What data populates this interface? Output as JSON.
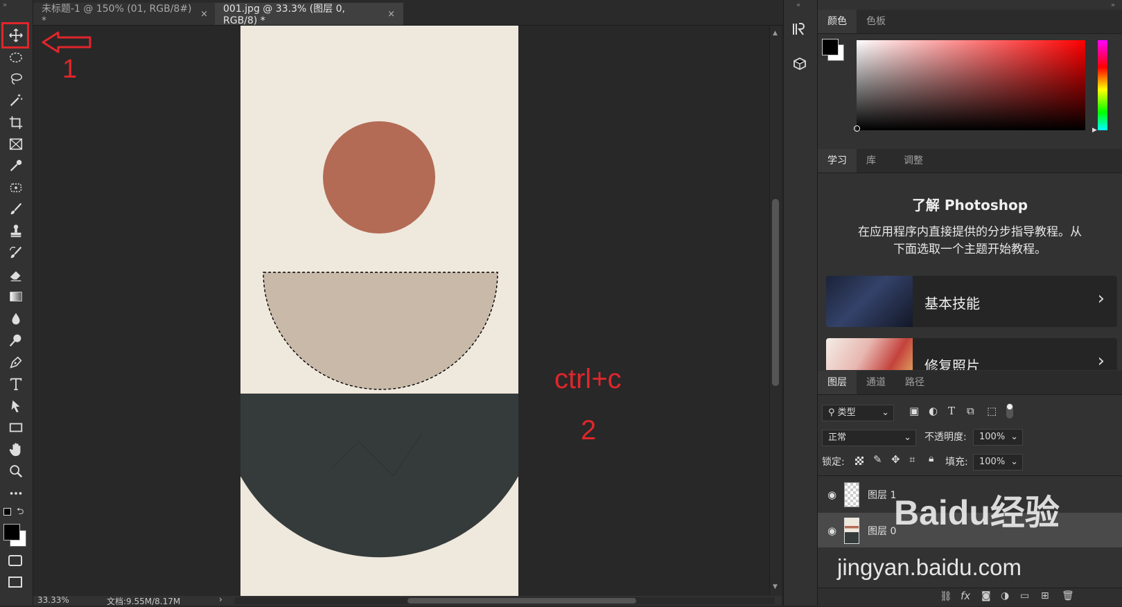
{
  "tabs": [
    {
      "label": "未标题-1 @ 150% (01, RGB/8#) *",
      "close": "×"
    },
    {
      "label": "001.jpg @ 33.3% (图层 0, RGB/8) *",
      "close": "×"
    }
  ],
  "tools": [
    "move-tool-icon",
    "elliptical-marquee-icon",
    "lasso-icon",
    "magic-wand-icon",
    "crop-icon",
    "frame-icon",
    "eyedropper-icon",
    "healing-brush-icon",
    "brush-icon",
    "clone-stamp-icon",
    "history-brush-icon",
    "eraser-icon",
    "gradient-icon",
    "blur-icon",
    "dodge-icon",
    "pen-icon",
    "type-icon",
    "path-selection-icon",
    "rectangle-icon",
    "hand-icon",
    "zoom-icon",
    "more-tools-icon"
  ],
  "annotations": {
    "step1": "1",
    "shortcut": "ctrl+c",
    "step2": "2"
  },
  "status": {
    "zoom": "33.33%",
    "doc": "文档:9.55M/8.17M",
    "arrow": "›"
  },
  "color_panel": {
    "tabs": [
      "颜色",
      "色板"
    ],
    "foreground": "#000000",
    "background": "#ffffff",
    "hue": "#ff0000"
  },
  "learn_panel": {
    "tabs": [
      "学习",
      "库",
      "调整"
    ],
    "title": "了解 Photoshop",
    "desc_line1": "在应用程序内直接提供的分步指导教程。从",
    "desc_line2": "下面选取一个主题开始教程。",
    "cards": [
      {
        "label": "基本技能"
      },
      {
        "label": "修复照片"
      }
    ]
  },
  "layers_panel": {
    "tabs": [
      "图层",
      "通道",
      "路径"
    ],
    "filter": "类型",
    "blend_mode": "正常",
    "opacity_label": "不透明度:",
    "opacity_value": "100%",
    "lock_label": "锁定:",
    "fill_label": "填充:",
    "fill_value": "100%",
    "layers": [
      {
        "name": "图层 1",
        "visible": true
      },
      {
        "name": "图层 0",
        "visible": true,
        "selected": true
      }
    ]
  },
  "watermark": {
    "brand": "Baidu经验",
    "url": "jingyan.baidu.com"
  },
  "artwork_colors": {
    "paper": "#efe8dd",
    "sun": "#b36b55",
    "selection_bowl": "#c8b9a9",
    "dark_block": "#353b3b"
  }
}
